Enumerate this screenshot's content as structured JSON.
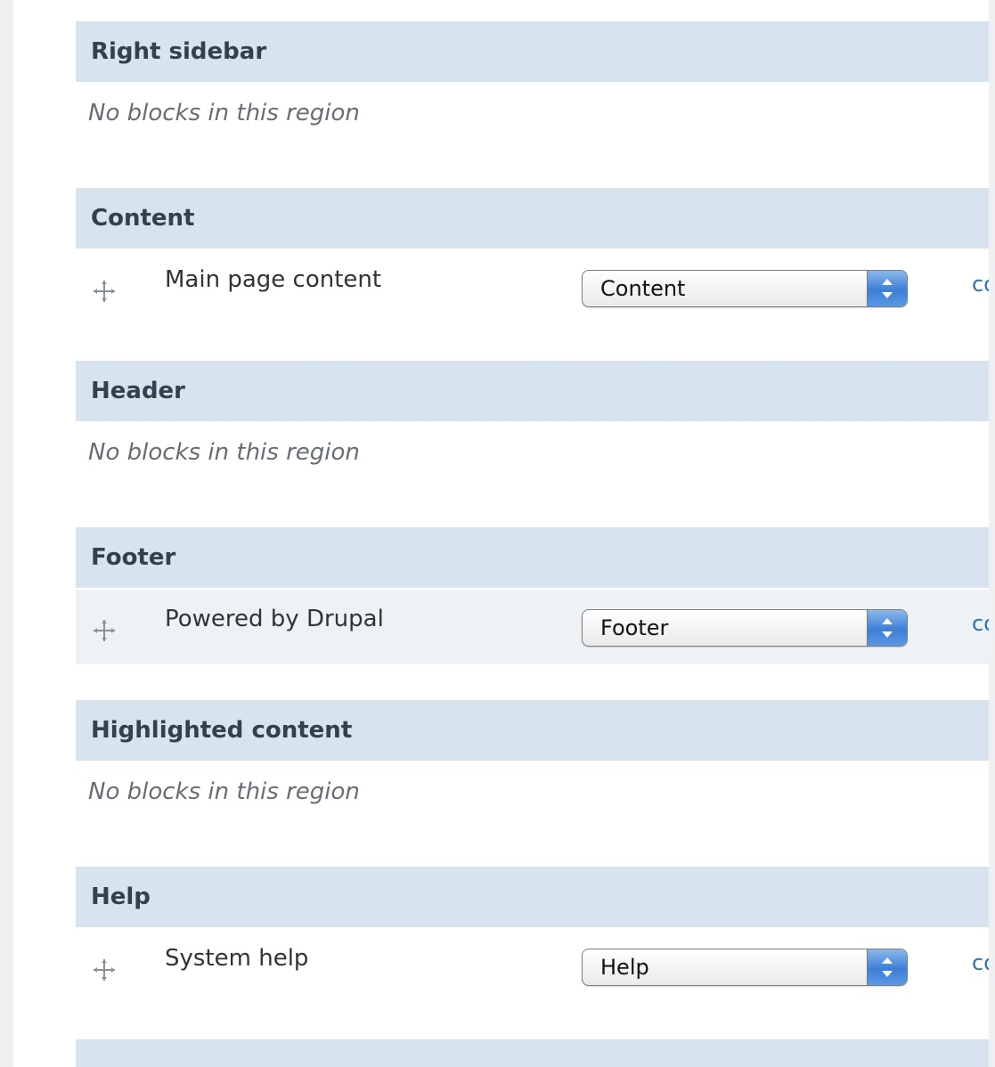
{
  "regions": [
    {
      "title": "Right sidebar",
      "empty_text": "No blocks in this region"
    },
    {
      "title": "Content",
      "block": {
        "name": "Main page content",
        "region_value": "Content",
        "link": "co"
      }
    },
    {
      "title": "Header",
      "empty_text": "No blocks in this region"
    },
    {
      "title": "Footer",
      "block": {
        "name": "Powered by Drupal",
        "region_value": "Footer",
        "link": "co"
      }
    },
    {
      "title": "Highlighted content",
      "empty_text": "No blocks in this region"
    },
    {
      "title": "Help",
      "block": {
        "name": "System help",
        "region_value": "Help",
        "link": "co"
      }
    }
  ],
  "icons": {
    "drag_handle": "drag-handle-icon",
    "select_arrows": "select-arrows-icon"
  },
  "colors": {
    "header_bg": "#d7e3ee",
    "header_text": "#33404d",
    "link": "#2a73b8",
    "empty_text": "#666d73"
  }
}
